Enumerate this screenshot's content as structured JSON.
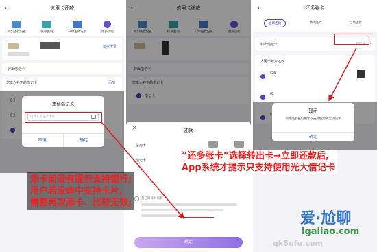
{
  "panel1": {
    "title": "信用卡还款",
    "icons": [
      {
        "label": "添加还款设置",
        "color": "#4d8cc9"
      },
      {
        "label": "账单查询",
        "color": "#3fa0a8"
      },
      {
        "label": "APP还款记录",
        "color": "#4577c9"
      },
      {
        "label": "更多功能",
        "color": "#6b4fc4"
      }
    ],
    "card_tag": "待还卡号",
    "card_link": "还款卡号",
    "debit_label": "转出借记卡",
    "list_header": "您本人名下的借记卡",
    "list_right": "添加",
    "dialog": {
      "title": "添加借记卡",
      "placeholder": "请输入借记卡卡号",
      "cancel": "取消",
      "confirm": "确定"
    }
  },
  "panel2": {
    "title": "信用卡还款",
    "icons": [
      {
        "label": "添加还款设置",
        "color": "#4d8cc9"
      },
      {
        "label": "账单查询",
        "color": "#3fa0a8"
      },
      {
        "label": "APP还款记录",
        "color": "#4577c9"
      },
      {
        "label": "更多功能",
        "color": "#6b4fc4"
      }
    ],
    "debit_label": "转出借记卡",
    "list_header": "您本人名下的借记卡",
    "list_item": "借记卡",
    "sheet": {
      "title": "还款",
      "close": "×",
      "row1": "信用卡",
      "row2": "借记卡",
      "agree": "我已阅读并同意",
      "button": "确定"
    }
  },
  "panel3": {
    "title": "还多张卡",
    "tabs": [
      "立即还款",
      "预约还款",
      "自动还款"
    ],
    "debit_label": "转出借记卡",
    "debit_value": "请选择",
    "section": "人民币账户还款",
    "items": [
      "625",
      "62",
      "62"
    ],
    "dialog": {
      "title": "提示",
      "message": "同时还多张信用卡仅支持使用光大借记卡",
      "confirm": "确定"
    }
  },
  "annotations": {
    "left": "添卡前没有提示支持银行;\n用户若没命中支持卡片,\n需要再次添卡、比较无效;",
    "right": "“还多张卡”选择转出卡→立即还款后,\nApp系统才提示只支持使用光大借记卡"
  },
  "watermark": {
    "brand": "爱·尬聊",
    "url": "igaliao.com",
    "url2": "qk5ufu.com"
  },
  "colors": {
    "accent": "#4b3fc4",
    "annotation": "#f02020"
  }
}
